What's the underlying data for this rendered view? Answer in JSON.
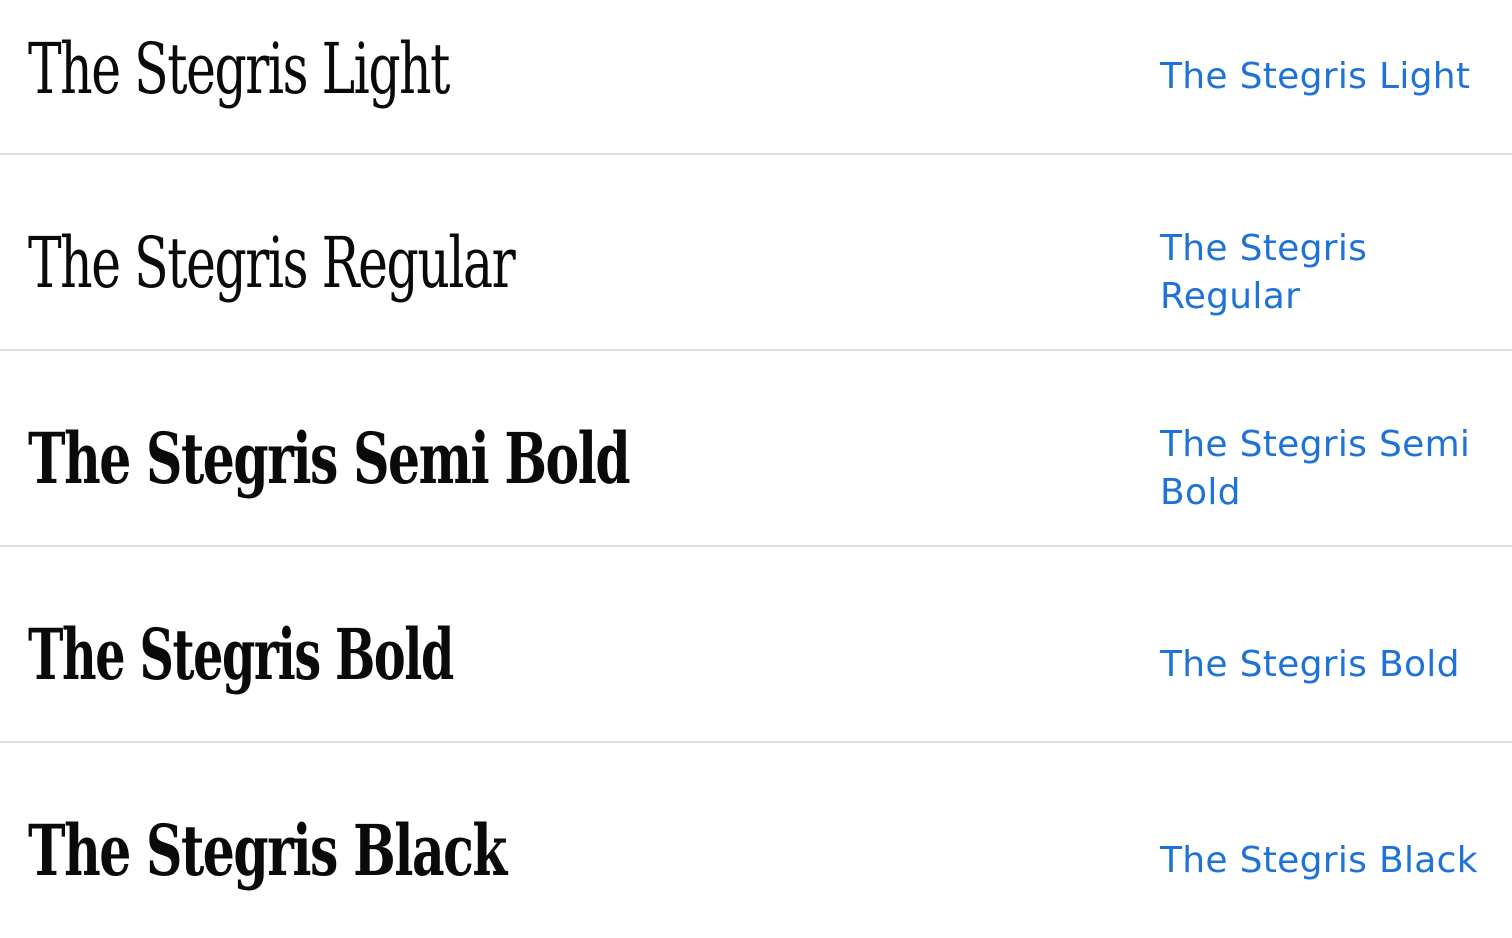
{
  "font_list": {
    "items": [
      {
        "preview": "The Stegris Light",
        "link_label": "The Stegris Light"
      },
      {
        "preview": "The Stegris Regular",
        "link_label": "The Stegris Regular"
      },
      {
        "preview": "The Stegris Semi Bold",
        "link_label": "The Stegris Semi Bold"
      },
      {
        "preview": "The Stegris Bold",
        "link_label": "The Stegris Bold"
      },
      {
        "preview": "The Stegris Black",
        "link_label": "The Stegris Black"
      }
    ]
  },
  "colors": {
    "link": "#1f73d8",
    "preview_text": "#0a0a0a",
    "divider": "#e0e0e0",
    "background": "#ffffff"
  }
}
